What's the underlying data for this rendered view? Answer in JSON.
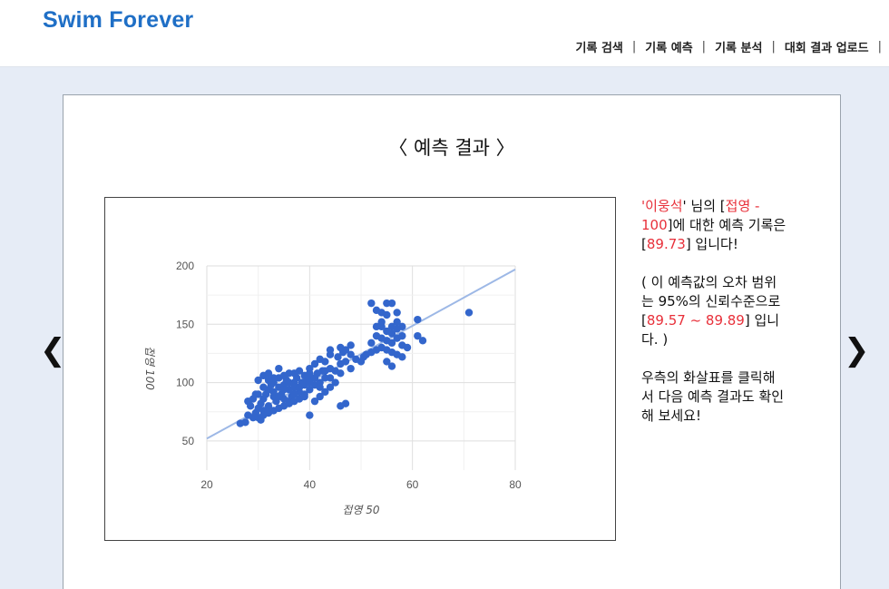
{
  "header": {
    "logo": "Swim Forever",
    "nav": [
      {
        "label": "기록 검색"
      },
      {
        "label": "기록 예측"
      },
      {
        "label": "기록 분석"
      },
      {
        "label": "대회 결과 업로드"
      }
    ],
    "separator": "|"
  },
  "main": {
    "title": "〈 예측 결과 〉",
    "prev_arrow": "❮",
    "next_arrow": "❯",
    "info": {
      "p1": {
        "q1": "'",
        "name": "이웅석",
        "q2": "' 님의 [",
        "event": "접영 - 100",
        "mid": "]에 대한 예측 기록은 [",
        "value": "89.73",
        "end": "] 입니다!"
      },
      "p2": {
        "start": "( 이 예측값의 오차 범위는 95%의 신뢰수준으로 [",
        "range": "89.57 ~ 89.89",
        "end": "] 입니다. )"
      },
      "p3": "우측의 화살표를 클릭해서 다음 예측 결과도 확인해 보세요!"
    },
    "accent_red": "#e8303a"
  },
  "chart_data": {
    "type": "scatter",
    "xlabel": "접영 50",
    "ylabel": "접영 100",
    "xlim": [
      20,
      80
    ],
    "ylim": [
      25,
      200
    ],
    "xticks": [
      "20",
      "40",
      "60",
      "80"
    ],
    "yticks": [
      "50",
      "100",
      "150",
      "200"
    ],
    "grid": true,
    "point_color": "#3366cc",
    "trendline": {
      "x": [
        20,
        80
      ],
      "y": [
        52,
        197
      ],
      "color": "#9db8e6"
    },
    "points": [
      [
        26.5,
        65
      ],
      [
        27.5,
        66
      ],
      [
        28,
        72
      ],
      [
        29,
        70
      ],
      [
        29.5,
        74
      ],
      [
        30,
        78
      ],
      [
        30.5,
        82
      ],
      [
        31,
        86
      ],
      [
        31,
        76
      ],
      [
        31.5,
        90
      ],
      [
        32,
        94
      ],
      [
        32,
        80
      ],
      [
        32.5,
        98
      ],
      [
        33,
        88
      ],
      [
        33,
        100
      ],
      [
        33.5,
        84
      ],
      [
        34,
        96
      ],
      [
        34,
        104
      ],
      [
        34.5,
        90
      ],
      [
        35,
        98
      ],
      [
        35,
        86
      ],
      [
        35.5,
        102
      ],
      [
        36,
        94
      ],
      [
        36,
        108
      ],
      [
        36.5,
        88
      ],
      [
        37,
        100
      ],
      [
        37,
        96
      ],
      [
        37.5,
        104
      ],
      [
        38,
        92
      ],
      [
        38,
        110
      ],
      [
        38.5,
        100
      ],
      [
        39,
        98
      ],
      [
        39,
        106
      ],
      [
        39.5,
        102
      ],
      [
        40,
        94
      ],
      [
        40,
        112
      ],
      [
        40.5,
        104
      ],
      [
        41,
        98
      ],
      [
        41,
        116
      ],
      [
        41.5,
        108
      ],
      [
        42,
        100
      ],
      [
        42,
        120
      ],
      [
        42.5,
        110
      ],
      [
        43,
        104
      ],
      [
        43,
        118
      ],
      [
        44,
        112
      ],
      [
        44,
        124
      ],
      [
        45,
        110
      ],
      [
        45.5,
        122
      ],
      [
        46,
        116
      ],
      [
        46.5,
        126
      ],
      [
        47,
        118
      ],
      [
        48,
        112
      ],
      [
        48,
        132
      ],
      [
        33,
        104
      ],
      [
        34,
        112
      ],
      [
        35,
        106
      ],
      [
        36,
        100
      ],
      [
        37,
        108
      ],
      [
        30,
        90
      ],
      [
        29,
        86
      ],
      [
        28,
        84
      ],
      [
        31,
        96
      ],
      [
        32,
        102
      ],
      [
        33,
        92
      ],
      [
        34,
        88
      ],
      [
        35,
        94
      ],
      [
        36,
        84
      ],
      [
        37,
        90
      ],
      [
        38,
        96
      ],
      [
        39,
        90
      ],
      [
        40,
        100
      ],
      [
        40,
        108
      ],
      [
        41,
        104
      ],
      [
        42,
        96
      ],
      [
        43,
        110
      ],
      [
        44,
        104
      ],
      [
        45,
        100
      ],
      [
        46,
        108
      ],
      [
        30,
        102
      ],
      [
        31,
        106
      ],
      [
        32,
        108
      ],
      [
        30,
        70
      ],
      [
        30.5,
        68
      ],
      [
        31,
        72
      ],
      [
        32,
        74
      ],
      [
        33,
        76
      ],
      [
        34,
        78
      ],
      [
        35,
        80
      ],
      [
        36,
        82
      ],
      [
        37,
        84
      ],
      [
        38,
        86
      ],
      [
        39,
        88
      ],
      [
        28.5,
        80
      ],
      [
        29.5,
        90
      ],
      [
        40,
        72
      ],
      [
        41,
        84
      ],
      [
        42,
        88
      ],
      [
        43,
        92
      ],
      [
        44,
        96
      ],
      [
        46,
        80
      ],
      [
        47,
        82
      ],
      [
        44,
        128
      ],
      [
        46,
        130
      ],
      [
        47,
        128
      ],
      [
        48,
        124
      ],
      [
        49,
        120
      ],
      [
        50,
        118
      ],
      [
        50.5,
        122
      ],
      [
        51,
        124
      ],
      [
        52,
        126
      ],
      [
        52,
        168
      ],
      [
        53,
        162
      ],
      [
        54,
        160
      ],
      [
        55,
        158
      ],
      [
        55,
        168
      ],
      [
        56,
        168
      ],
      [
        57,
        152
      ],
      [
        57,
        160
      ],
      [
        58,
        148
      ],
      [
        54,
        148
      ],
      [
        55,
        144
      ],
      [
        56,
        142
      ],
      [
        53,
        140
      ],
      [
        54,
        138
      ],
      [
        55,
        136
      ],
      [
        56,
        134
      ],
      [
        57,
        138
      ],
      [
        58,
        140
      ],
      [
        54,
        130
      ],
      [
        55,
        128
      ],
      [
        56,
        126
      ],
      [
        57,
        124
      ],
      [
        58,
        122
      ],
      [
        55,
        118
      ],
      [
        56,
        114
      ],
      [
        53,
        128
      ],
      [
        52,
        134
      ],
      [
        58,
        132
      ],
      [
        59,
        130
      ],
      [
        61,
        154
      ],
      [
        61,
        140
      ],
      [
        62,
        136
      ],
      [
        71,
        160
      ],
      [
        56,
        148
      ],
      [
        57,
        146
      ],
      [
        54,
        152
      ],
      [
        53,
        148
      ]
    ]
  }
}
